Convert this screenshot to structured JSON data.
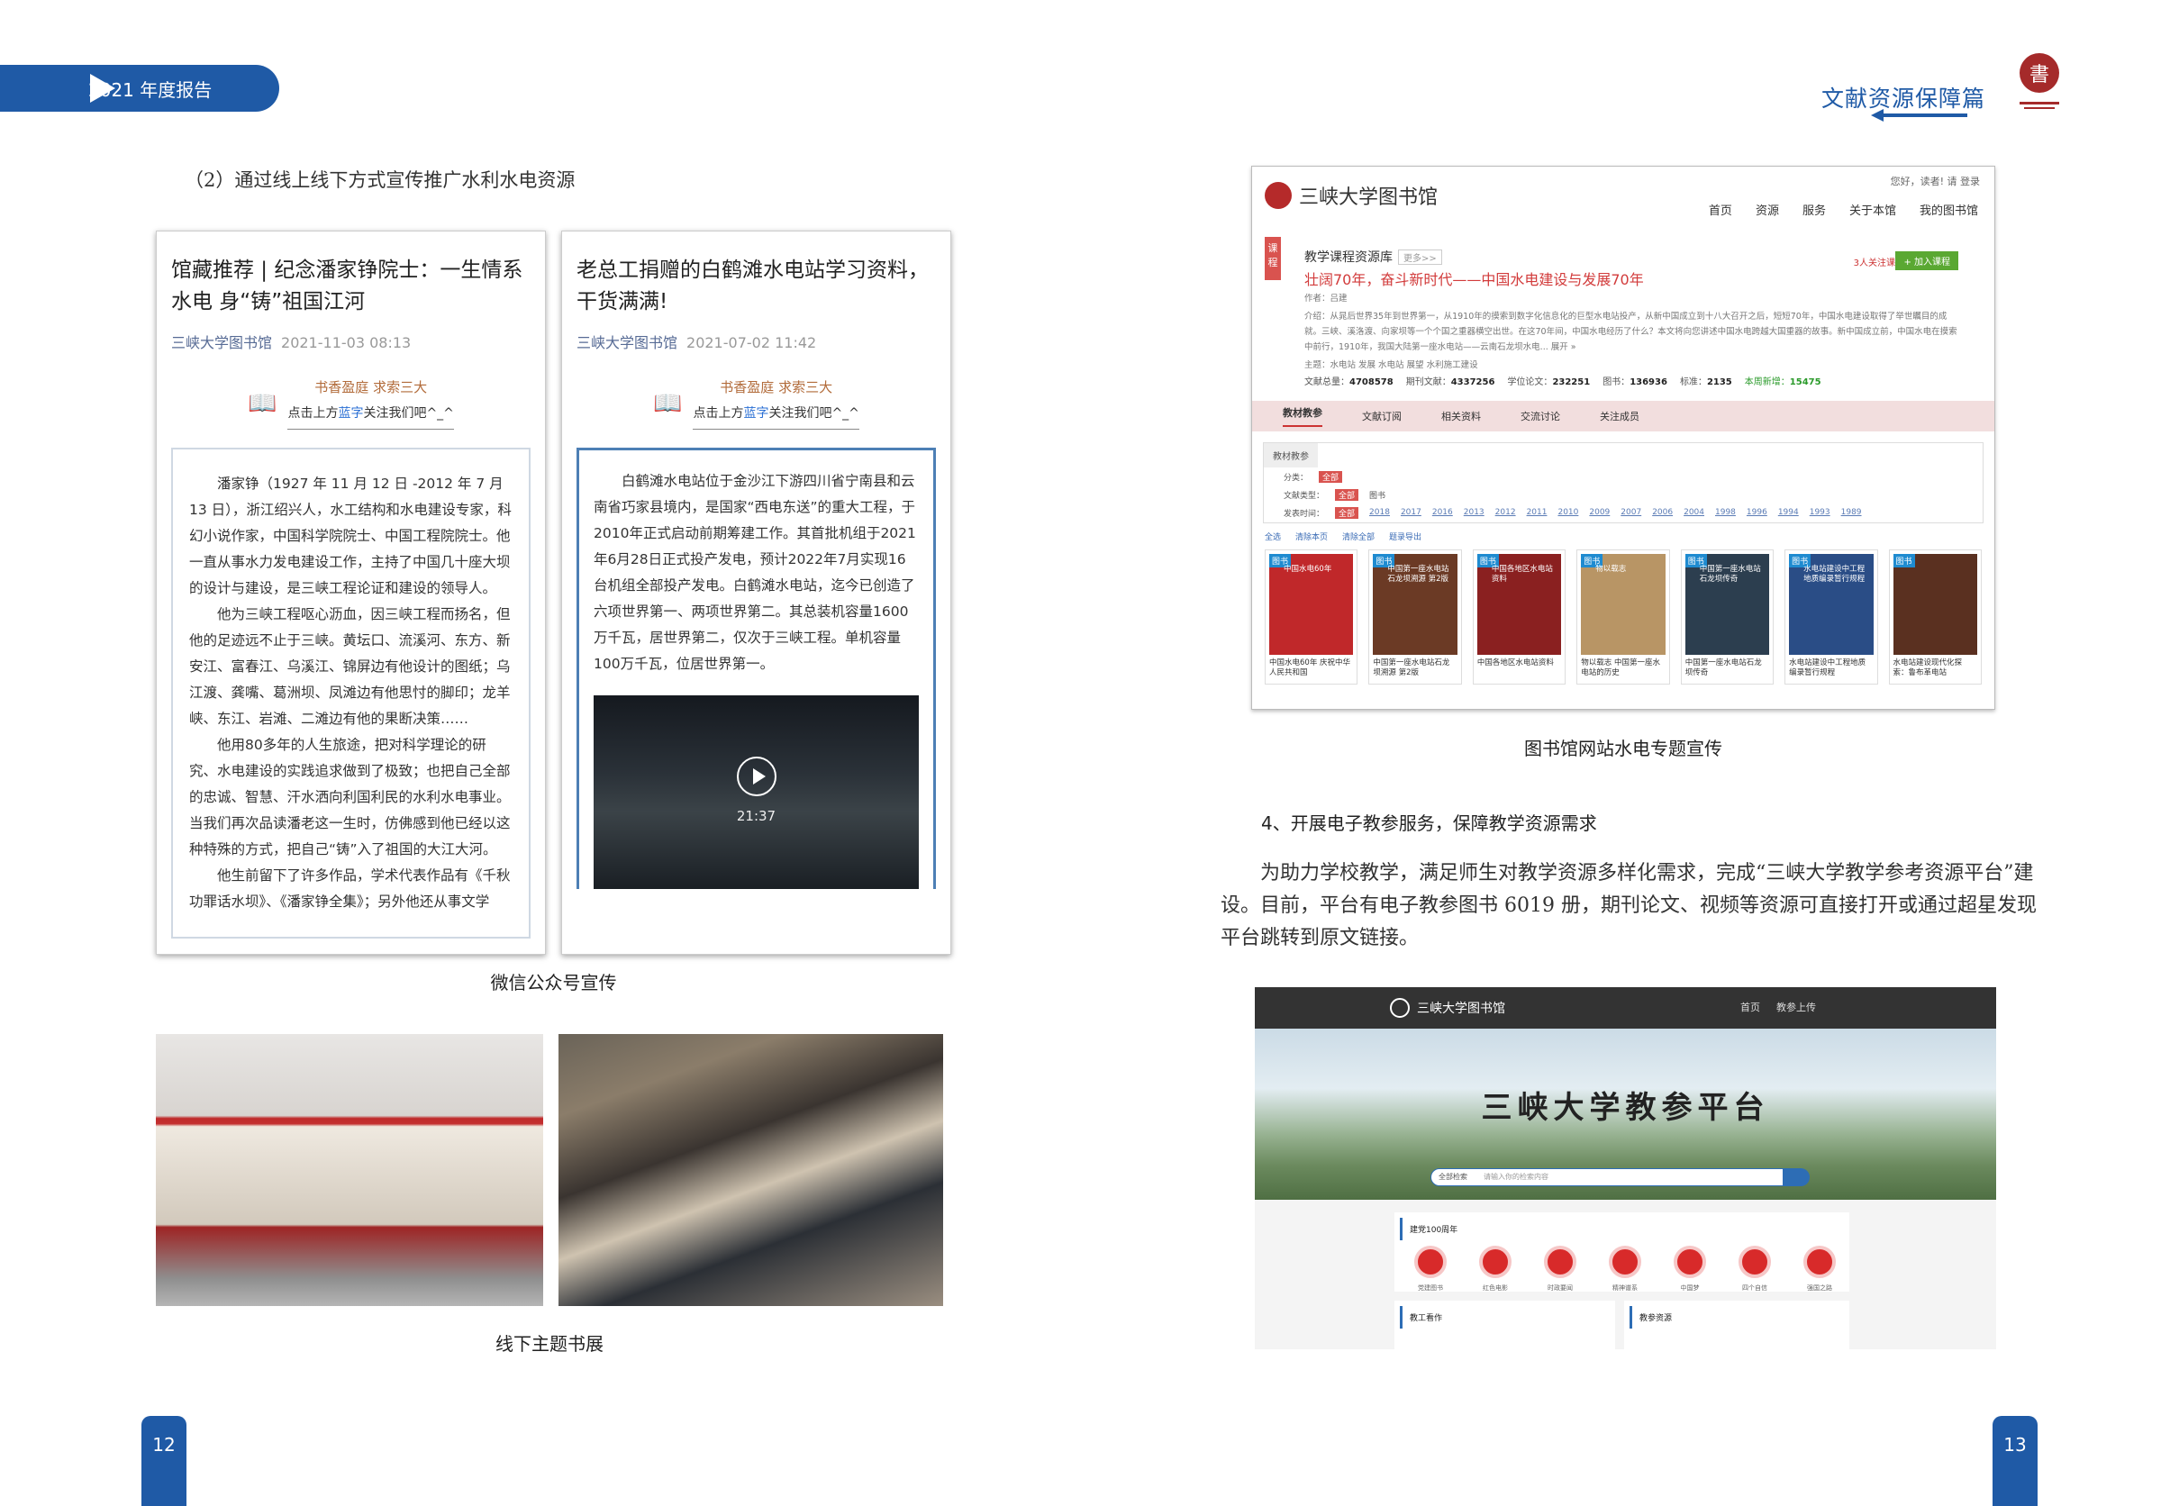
{
  "header": {
    "report_label": "2021 年度报告",
    "section_title": "文献资源保障篇"
  },
  "left": {
    "heading": "（2）通过线上线下方式宣传推广水利水电资源",
    "post1": {
      "title": "馆藏推荐 | 纪念潘家铮院士：一生情系水电 身“铸”祖国江河",
      "source": "三峡大学图书馆",
      "date": "2021-11-03 08:13",
      "slogan_line1": "书香盈庭 求索三大",
      "slogan_pre": "点击上方",
      "slogan_blue": "蓝字",
      "slogan_post": "关注我们吧^_^",
      "paragraphs": [
        "潘家铮（1927 年 11 月 12 日 -2012 年 7 月 13 日），浙江绍兴人，水工结构和水电建设专家，科幻小说作家，中国科学院院士、中国工程院院士。他一直从事水力发电建设工作，主持了中国几十座大坝的设计与建设，是三峡工程论证和建设的领导人。",
        "他为三峡工程呕心沥血，因三峡工程而扬名，但他的足迹远不止于三峡。黄坛口、流溪河、东方、新安江、富春江、乌溪江、锦屏边有他设计的图纸；乌江渡、龚嘴、葛洲坝、凤滩边有他思忖的脚印；龙羊峡、东江、岩滩、二滩边有他的果断决策……",
        "他用80多年的人生旅途，把对科学理论的研究、水电建设的实践追求做到了极致；也把自己全部的忠诚、智慧、汗水洒向利国利民的水利水电事业。当我们再次品读潘老这一生时，仿佛感到他已经以这种特殊的方式，把自己“铸”入了祖国的大江大河。",
        "他生前留下了许多作品，学术代表作品有《千秋功罪话水坝》、《潘家铮全集》；另外他还从事文学"
      ]
    },
    "post2": {
      "title": "老总工捐赠的白鹤滩水电站学习资料，干货满满!",
      "source": "三峡大学图书馆",
      "date": "2021-07-02 11:42",
      "slogan_line1": "书香盈庭 求索三大",
      "slogan_pre": "点击上方",
      "slogan_blue": "蓝字",
      "slogan_post": "关注我们吧^_^",
      "paragraph": "白鹤滩水电站位于金沙江下游四川省宁南县和云南省巧家县境内，是国家“西电东送”的重大工程，于2010年正式启动前期筹建工作。其首批机组于2021年6月28日正式投产发电，预计2022年7月实现16台机组全部投产发电。白鹤滩水电站，迄今已创造了六项世界第一、两项世界第二。其总装机容量1600万千瓦，居世界第二，仅次于三峡工程。单机容量100万千瓦，位居世界第一。",
      "video_time": "21:37"
    },
    "caption_wechat": "微信公众号宣传",
    "caption_offline": "线下主题书展",
    "page_number": "12"
  },
  "right": {
    "library_site": {
      "logo": "三峡大学图书馆",
      "login": "您好，读者!  请 登录",
      "nav": [
        "首页",
        "资源",
        "服务",
        "关于本馆",
        "我的图书馆"
      ],
      "tag": "课程",
      "course_title": "教学课程资源库",
      "more": "更多>>",
      "subtitle": "壮阔70年，奋斗新时代——中国水电建设与发展70年",
      "author": "作者：吕建",
      "intro": "介绍：从晁后世界35年到世界第一，从1910年的摸索到数字化信息化的巨型水电站投产，从新中国成立到十八大召开之后，短短70年，中国水电建设取得了举世瞩目的成就。三峡、溪洛渡、向家坝等一个个国之重器横空出世。在这70年间，中国水电经历了什么？本文将向您讲述中国水电跨越大国重器的故事。新中国成立前，中国水电在摸索中前行，1910年，我国大陆第一座水电站——云南石龙坝水电...  展开 »",
      "subject": "主题：水电站  发展  水电站 展望  水利施工建设",
      "fans": "3人关注课程",
      "join": "+ 加入课程",
      "stats": [
        {
          "k": "文献总量：",
          "v": "4708578"
        },
        {
          "k": "期刊文献：",
          "v": "4337256"
        },
        {
          "k": "学位论文：",
          "v": "232251"
        },
        {
          "k": "图书：",
          "v": "136936"
        },
        {
          "k": "标准：",
          "v": "2135"
        },
        {
          "k": "本周新增：",
          "v": "15475"
        }
      ],
      "tabs": [
        "教材教参",
        "文献订阅",
        "相关资料",
        "交流讨论",
        "关注成员"
      ],
      "filter_head": "教材教参",
      "filter_rows": [
        {
          "label": "分类：",
          "items": [
            "全部"
          ]
        },
        {
          "label": "文献类型：",
          "items": [
            "全部",
            "图书"
          ]
        },
        {
          "label": "发表时间：",
          "items": [
            "全部",
            "2018",
            "2017",
            "2016",
            "2013",
            "2012",
            "2011",
            "2010",
            "2009",
            "2007",
            "2006",
            "2004",
            "1998",
            "1996",
            "1994",
            "1993",
            "1989"
          ]
        }
      ],
      "checks": [
        "全选",
        "清除本页",
        "清除全部",
        "题录导出"
      ],
      "books": [
        {
          "type": "图书",
          "cover": "中国水电60年",
          "name": "中国水电60年 庆祝中华人民共和国",
          "color": "#c0282a"
        },
        {
          "type": "图书",
          "cover": "中国第一座水电站石龙坝溯源 第2版",
          "name": "中国第一座水电站石龙坝溯源 第2版",
          "color": "#6b3a25"
        },
        {
          "type": "图书",
          "cover": "中国各地区水电站资料",
          "name": "中国各地区水电站资料",
          "color": "#8a2020"
        },
        {
          "type": "图书",
          "cover": "物以载志",
          "name": "物以载志 中国第一座水电站的历史",
          "color": "#b89565"
        },
        {
          "type": "图书",
          "cover": "中国第一座水电站石龙坝传奇",
          "name": "中国第一座水电站石龙坝传奇",
          "color": "#2c3e4f"
        },
        {
          "type": "图书",
          "cover": "水电站建设中工程地质编录暂行规程",
          "name": "水电站建设中工程地质编录暂行规程",
          "color": "#2a4d86"
        },
        {
          "type": "图书",
          "cover": "",
          "name": "水电站建设现代化探索：鲁布革电站",
          "color": "#5a3020"
        }
      ]
    },
    "caption_site": "图书馆网站水电专题宣传",
    "heading4": "4、开展电子教参服务，保障教学资源需求",
    "body": "为助力学校教学，满足师生对教学资源多样化需求，完成“三峡大学教学参考资源平台”建设。目前，平台有电子教参图书 6019 册，期刊论文、视频等资源可直接打开或通过超星发现平台跳转到原文链接。",
    "edu": {
      "logo": "三峡大学图书馆",
      "nav": [
        "首页",
        "教参上传"
      ],
      "banner": "三峡大学教参平台",
      "search_cat": "全部检索",
      "search_ph": "请输入你的检索内容",
      "section1": "建党100周年",
      "icons": [
        "党建图书",
        "红色电影",
        "时政要闻",
        "精神谱系",
        "中国梦",
        "四个自信",
        "强国之路"
      ],
      "section2": "教工看作",
      "section3": "教参资源"
    },
    "page_number": "13"
  }
}
